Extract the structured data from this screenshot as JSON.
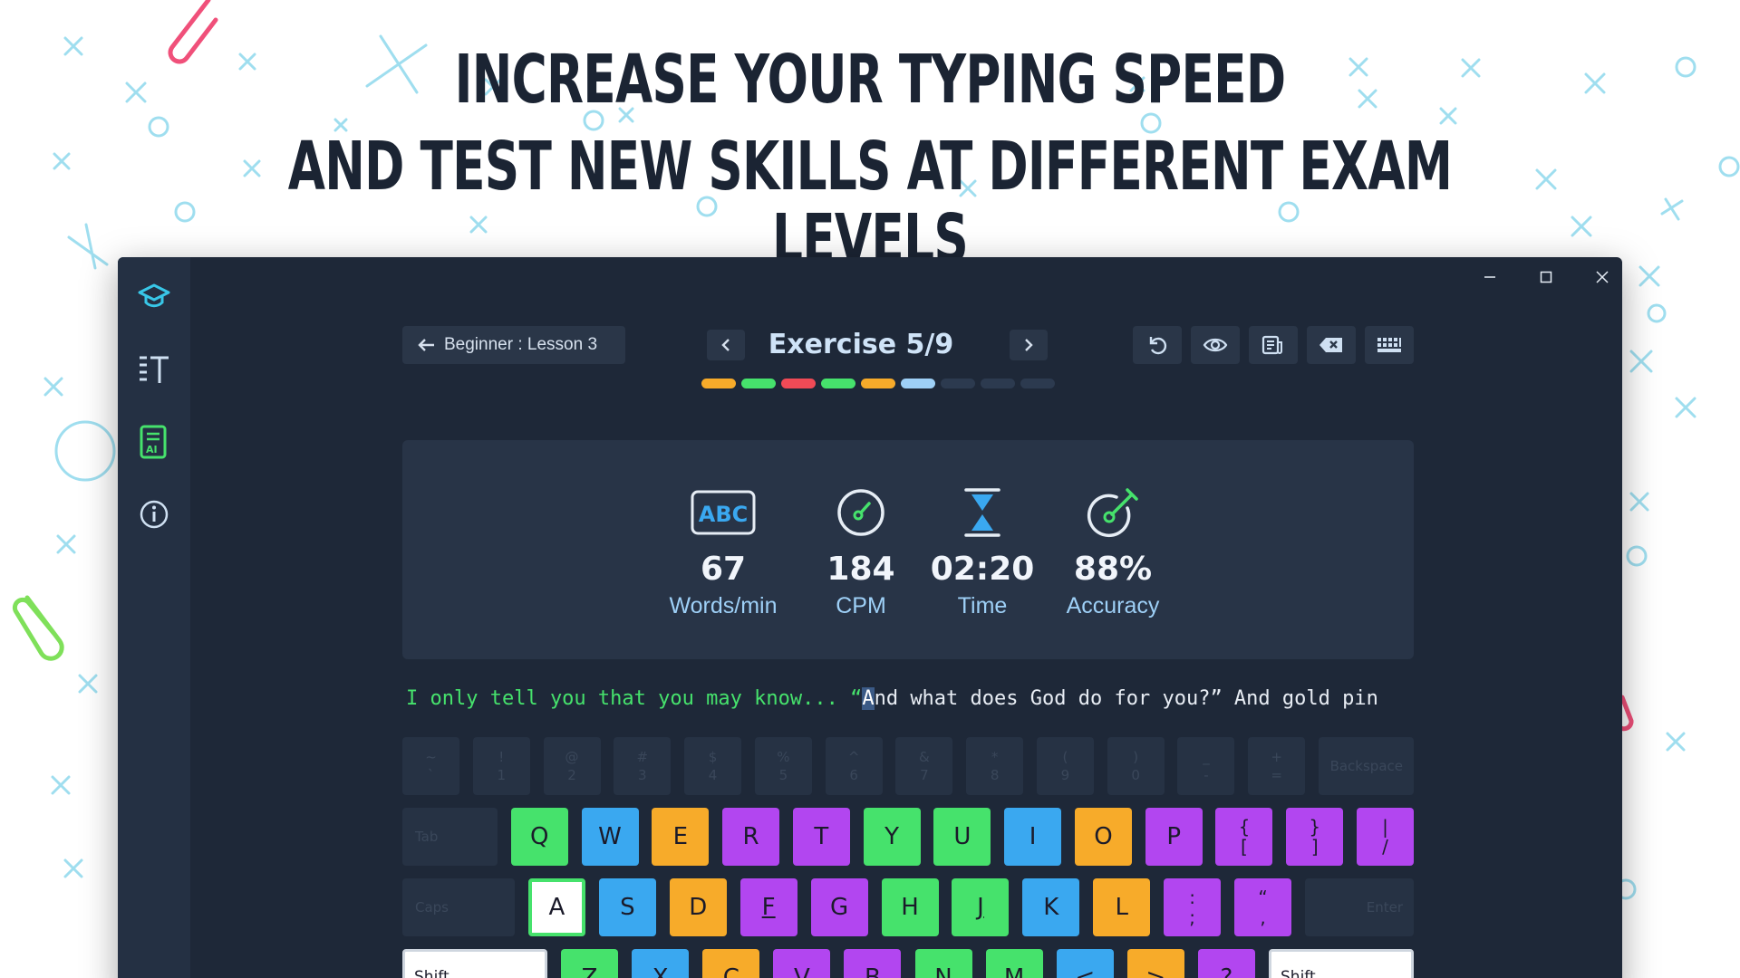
{
  "headline": {
    "line1": "INCREASE YOUR TYPING SPEED",
    "line2": "AND TEST NEW SKILLS AT DIFFERENT EXAM LEVELS"
  },
  "colors": {
    "green": "#46e26c",
    "blue": "#3aa8f0",
    "orange": "#f7ab2a",
    "purple": "#b246f0",
    "red": "#f04a56",
    "light_blue": "#9ed0f7"
  },
  "sidebar": {
    "items": [
      {
        "icon": "graduation-cap-icon"
      },
      {
        "icon": "text-size-icon"
      },
      {
        "icon": "ai-document-icon"
      },
      {
        "icon": "info-icon"
      }
    ]
  },
  "header": {
    "lesson_label": "Beginner : Lesson 3",
    "exercise_title": "Exercise 5/9",
    "progress": {
      "total": 9,
      "current": 6,
      "segments": [
        "orange",
        "green",
        "red",
        "green",
        "orange",
        "current",
        "pending",
        "pending",
        "pending"
      ]
    },
    "tools": [
      "restart-icon",
      "eye-icon",
      "book-icon",
      "backspace-icon",
      "keyboard-icon"
    ]
  },
  "stats": [
    {
      "icon": "abc-icon",
      "icon_text": "ABC",
      "value": "67",
      "label": "Words/min"
    },
    {
      "icon": "speedometer-icon",
      "value": "184",
      "label": "CPM"
    },
    {
      "icon": "hourglass-icon",
      "value": "02:20",
      "label": "Time"
    },
    {
      "icon": "target-icon",
      "value": "88%",
      "label": "Accuracy"
    }
  ],
  "typing": {
    "typed": "I only tell you that you may know... “",
    "cursor": "A",
    "remaining": "nd what does God do for you?” And gold pin"
  },
  "keyboard": {
    "row0": [
      {
        "top": "~",
        "bot": "`"
      },
      {
        "top": "!",
        "bot": "1"
      },
      {
        "top": "@",
        "bot": "2"
      },
      {
        "top": "#",
        "bot": "3"
      },
      {
        "top": "$",
        "bot": "4"
      },
      {
        "top": "%",
        "bot": "5"
      },
      {
        "top": "^",
        "bot": "6"
      },
      {
        "top": "&",
        "bot": "7"
      },
      {
        "top": "*",
        "bot": "8"
      },
      {
        "top": "(",
        "bot": "9"
      },
      {
        "top": ")",
        "bot": "0"
      },
      {
        "top": "_",
        "bot": "-"
      },
      {
        "top": "+",
        "bot": "="
      },
      {
        "label": "Backspace"
      }
    ],
    "row1": [
      {
        "label": "Tab"
      },
      {
        "label": "Q",
        "color": "green"
      },
      {
        "label": "W",
        "color": "blue"
      },
      {
        "label": "E",
        "color": "orange"
      },
      {
        "label": "R",
        "color": "purple"
      },
      {
        "label": "T",
        "color": "purple"
      },
      {
        "label": "Y",
        "color": "green"
      },
      {
        "label": "U",
        "color": "green"
      },
      {
        "label": "I",
        "color": "blue"
      },
      {
        "label": "O",
        "color": "orange"
      },
      {
        "label": "P",
        "color": "purple"
      },
      {
        "top": "{",
        "bot": "[",
        "color": "purple"
      },
      {
        "top": "}",
        "bot": "]",
        "color": "purple"
      },
      {
        "top": "|",
        "bot": "/",
        "color": "purple"
      }
    ],
    "row2": [
      {
        "label": "Caps"
      },
      {
        "label": "A",
        "color": "green",
        "target": true
      },
      {
        "label": "S",
        "color": "blue"
      },
      {
        "label": "D",
        "color": "orange"
      },
      {
        "label": "F",
        "color": "purple",
        "underline": true
      },
      {
        "label": "G",
        "color": "purple"
      },
      {
        "label": "H",
        "color": "green"
      },
      {
        "label": "J",
        "color": "green",
        "underline": true
      },
      {
        "label": "K",
        "color": "blue"
      },
      {
        "label": "L",
        "color": "orange"
      },
      {
        "top": ":",
        "bot": ";",
        "color": "purple"
      },
      {
        "top": "“",
        "bot": ",",
        "color": "purple"
      },
      {
        "label": "Enter"
      }
    ],
    "row3": [
      {
        "label": "Shift"
      },
      {
        "label": "Z",
        "color": "green"
      },
      {
        "label": "X",
        "color": "blue"
      },
      {
        "label": "C",
        "color": "orange"
      },
      {
        "label": "V",
        "color": "purple"
      },
      {
        "label": "B",
        "color": "purple"
      },
      {
        "label": "N",
        "color": "green"
      },
      {
        "label": "M",
        "color": "green"
      },
      {
        "label": "<",
        "color": "blue"
      },
      {
        "label": ">",
        "color": "orange"
      },
      {
        "label": "?",
        "color": "purple"
      },
      {
        "label": "Shift"
      }
    ]
  }
}
